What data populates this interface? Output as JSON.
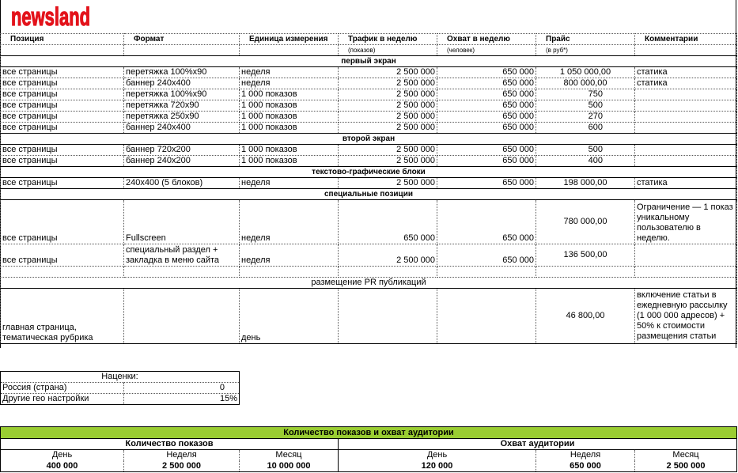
{
  "logo": {
    "text": "newsland",
    "color": "#e3131b"
  },
  "headers": {
    "position": "Позиция",
    "format": "Формат",
    "unit": "Единица измерения",
    "traffic": "Трафик в неделю",
    "traffic_sub": "(показов)",
    "reach": "Охват в неделю",
    "reach_sub": "(человек)",
    "price": "Прайс",
    "price_sub": "(в руб*)",
    "comments": "Комментарии"
  },
  "sections": {
    "first": "первый экран",
    "second": "второй экран",
    "text_graphic": "текстово-графические блоки",
    "special": "специальные позиции",
    "pr": "размещение PR публикаций"
  },
  "first_rows": [
    {
      "pos": "все страницы",
      "format": "перетяжка 100%x90",
      "unit": "неделя",
      "traffic": "2 500 000",
      "reach": "650 000",
      "price": "1 050 000,00",
      "comment": "статика",
      "price_align": "c"
    },
    {
      "pos": "все страницы",
      "format": "баннер 240x400",
      "unit": "неделя",
      "traffic": "2 500 000",
      "reach": "650 000",
      "price": "800 000,00",
      "comment": "статика",
      "price_align": "c"
    },
    {
      "pos": "все страницы",
      "format": "перетяжка 100%x90",
      "unit": "1 000 показов",
      "traffic": "2 500 000",
      "reach": "650 000",
      "price": "750",
      "comment": "",
      "price_align": "r"
    },
    {
      "pos": "все страницы",
      "format": "перетяжка  720x90",
      "unit": "1 000 показов",
      "traffic": "2 500 000",
      "reach": "650 000",
      "price": "500",
      "comment": "",
      "price_align": "r"
    },
    {
      "pos": "все страницы",
      "format": "перетяжка  250x90",
      "unit": "1 000 показов",
      "traffic": "2 500 000",
      "reach": "650 000",
      "price": "270",
      "comment": "",
      "price_align": "r"
    },
    {
      "pos": "все страницы",
      "format": "баннер 240x400",
      "unit": "1 000 показов",
      "traffic": "2 500 000",
      "reach": "650 000",
      "price": "600",
      "comment": "",
      "price_align": "r"
    }
  ],
  "second_rows": [
    {
      "pos": "все страницы",
      "format": "баннер 720x200",
      "unit": "1 000 показов",
      "traffic": "2 500 000",
      "reach": "650 000",
      "price": "500",
      "comment": ""
    },
    {
      "pos": "все страницы",
      "format": "баннер 240x200",
      "unit": "1 000 показов",
      "traffic": "2 500 000",
      "reach": "650 000",
      "price": "400",
      "comment": ""
    }
  ],
  "tg_row": {
    "pos": "все страницы",
    "format": "240x400 (5 блоков)",
    "unit": "неделя",
    "traffic": "2 500 000",
    "reach": "650 000",
    "price": "198 000,00",
    "comment": "статика"
  },
  "special_rows": [
    {
      "pos": "все страницы",
      "format": "Fullscreen",
      "unit": "неделя",
      "traffic": "650 000",
      "reach": "650 000",
      "price": "780 000,00",
      "comment": "Ограничение — 1 показ уникальному пользователю в неделю."
    },
    {
      "pos": "все страницы",
      "format": "специальный раздел + закладка в меню сайта",
      "unit": "неделя",
      "traffic": "2 500 000",
      "reach": "650 000",
      "price": "136 500,00",
      "comment": ""
    }
  ],
  "pr_row": {
    "pos": "главная страница, тематическая рубрика",
    "unit": "день",
    "price": "46 800,00",
    "comment": "включение статьи в ежедневную рассылку (1 000 000 адресов) + 50% к стоимости размещения статьи"
  },
  "markups": {
    "title": "Наценки:",
    "rows": [
      {
        "label": "Россия (страна)",
        "value": "0"
      },
      {
        "label": "Другие гео настройки",
        "value": "15%"
      }
    ]
  },
  "audience": {
    "title": "Количество показов и охват аудитории",
    "impressions_title": "Количество показов",
    "reach_title": "Охват аудитории",
    "labels": {
      "day": "День",
      "week": "Неделя",
      "month": "Месяц"
    },
    "impressions": {
      "day": "400 000",
      "week": "2 500 000",
      "month": "10 000 000"
    },
    "reach": {
      "day": "120 000",
      "week": "650 000",
      "month": "2 500 000"
    },
    "bar_color": "#9acd32"
  }
}
